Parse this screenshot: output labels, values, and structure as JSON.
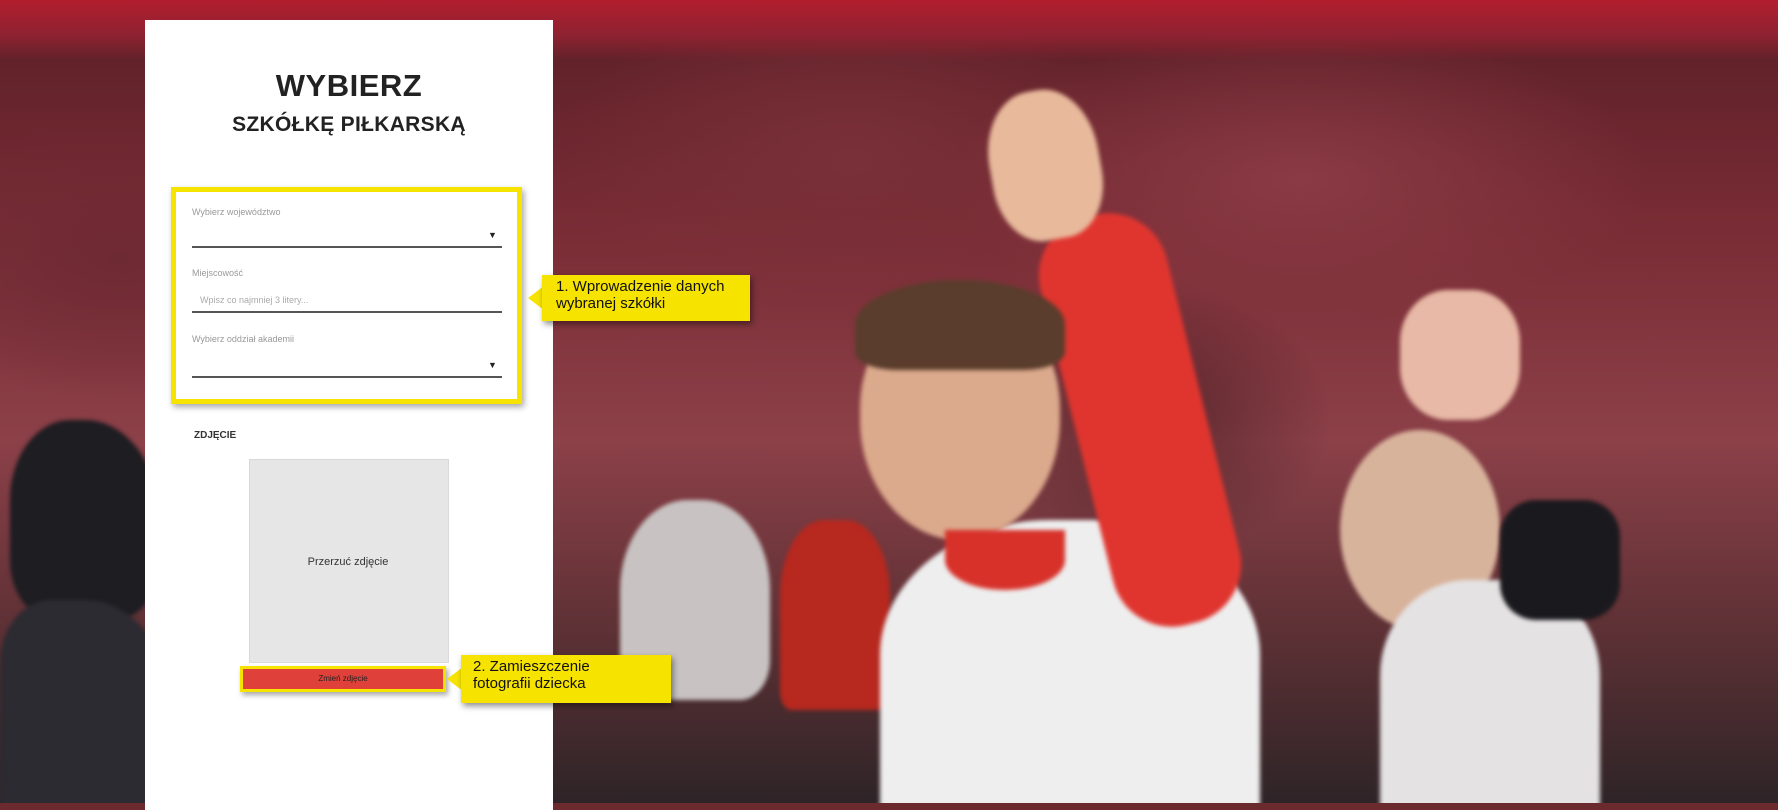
{
  "form": {
    "title_line1": "WYBIERZ",
    "title_line2": "SZKÓŁKĘ PIŁKARSKĄ",
    "voivodeship": {
      "label": "Wybierz województwo",
      "value": ""
    },
    "city": {
      "label": "Miejscowość",
      "placeholder": "Wpisz co najmniej 3 litery..."
    },
    "branch": {
      "label": "Wybierz oddział akademii",
      "value": ""
    },
    "photo_section": "ZDJĘCIE",
    "photo_drop_text": "Przerzuć zdjęcie",
    "change_photo_button": "Zmień zdjęcie"
  },
  "annotations": {
    "callout1": [
      "1. Wprowadzenie danych",
      "wybranej szkółki"
    ],
    "callout2": [
      "2. Zamieszczenie",
      "fotografii dziecka"
    ]
  },
  "icons": {
    "dropdown": "caret-down-icon"
  },
  "colors": {
    "highlight": "#f6e300",
    "button": "#e0403a",
    "panel": "#ffffff"
  }
}
